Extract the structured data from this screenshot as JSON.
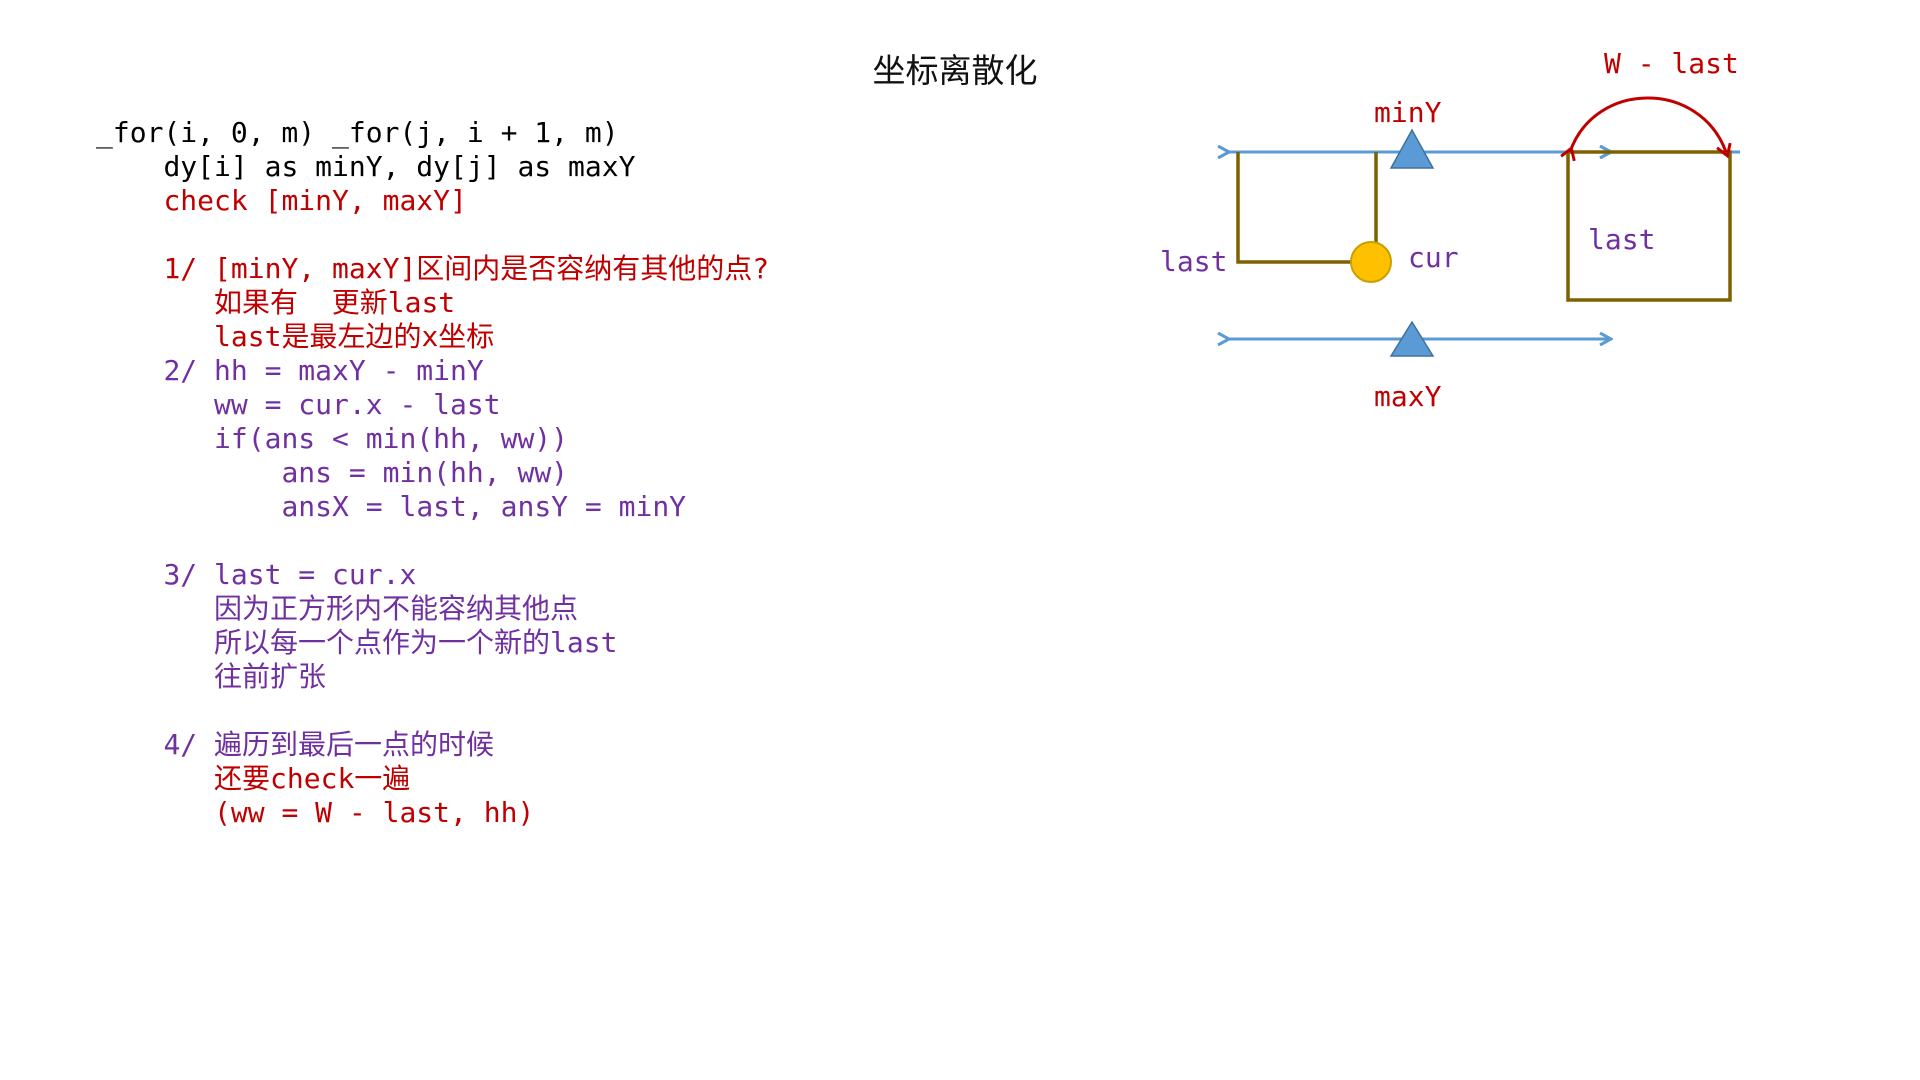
{
  "title": "坐标离散化",
  "code_lines": [
    {
      "text": "_for(i, 0, m) _for(j, i + 1, m)",
      "indent": 0,
      "color": "#000000"
    },
    {
      "text": "dy[i] as minY, dy[j] as maxY",
      "indent": 4,
      "color": "#000000"
    },
    {
      "text": "check [minY, maxY]",
      "indent": 4,
      "color": "#c00000"
    },
    {
      "text": "",
      "indent": 0,
      "color": "#000000"
    },
    {
      "text": "1/ [minY, maxY]区间内是否容纳有其他的点?",
      "indent": 4,
      "color": "#c00000"
    },
    {
      "text": "如果有  更新last",
      "indent": 7,
      "color": "#c00000"
    },
    {
      "text": "last是最左边的x坐标",
      "indent": 7,
      "color": "#c00000"
    },
    {
      "text": "2/ hh = maxY - minY",
      "indent": 4,
      "color": "#7030a0"
    },
    {
      "text": "ww = cur.x - last",
      "indent": 7,
      "color": "#7030a0"
    },
    {
      "text": "if(ans < min(hh, ww))",
      "indent": 7,
      "color": "#7030a0"
    },
    {
      "text": "ans = min(hh, ww)",
      "indent": 11,
      "color": "#7030a0"
    },
    {
      "text": "ansX = last, ansY = minY",
      "indent": 11,
      "color": "#7030a0"
    },
    {
      "text": "",
      "indent": 0,
      "color": "#000000"
    },
    {
      "text": "3/ last = cur.x",
      "indent": 4,
      "color": "#7030a0"
    },
    {
      "text": "因为正方形内不能容纳其他点",
      "indent": 7,
      "color": "#7030a0"
    },
    {
      "text": "所以每一个点作为一个新的last",
      "indent": 7,
      "color": "#7030a0"
    },
    {
      "text": "往前扩张",
      "indent": 7,
      "color": "#7030a0"
    },
    {
      "text": "",
      "indent": 0,
      "color": "#000000"
    },
    {
      "text": "4/ 遍历到最后一点的时候",
      "indent": 4,
      "color": "#7030a0"
    },
    {
      "text": "还要check一遍",
      "indent": 7,
      "color": "#c00000"
    },
    {
      "text": "(ww = W - last, hh)",
      "indent": 7,
      "color": "#c00000"
    }
  ],
  "diagram": {
    "label_miny": "minY",
    "label_maxy": "maxY",
    "label_last_left": "last",
    "label_cur": "cur",
    "label_last_right": "last",
    "label_w_last": "W - last",
    "colors": {
      "axis": "#5b9bd5",
      "box": "#7f6000",
      "point": "#ffc000",
      "red": "#c00000",
      "purple": "#7030a0"
    }
  }
}
